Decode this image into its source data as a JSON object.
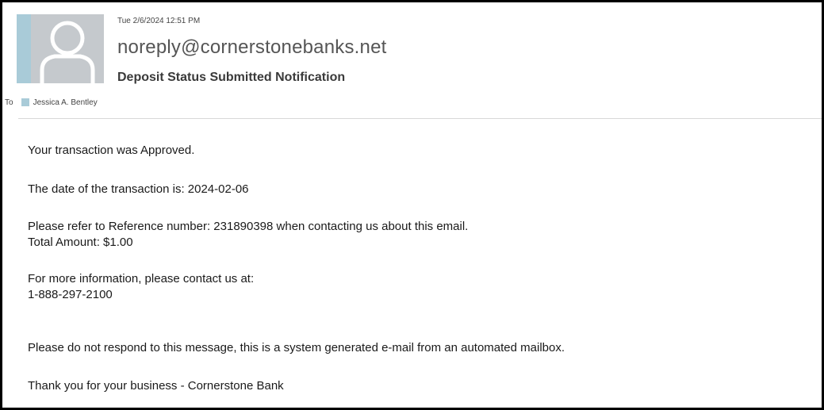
{
  "email": {
    "date": "Tue 2/6/2024 12:51 PM",
    "sender": "noreply@cornerstonebanks.net",
    "subject": "Deposit Status Submitted Notification",
    "to_label": "To",
    "recipient": "Jessica A. Bentley"
  },
  "body": {
    "line1": "Your transaction was Approved.",
    "line2": "The date of the transaction is: 2024-02-06",
    "line3": "Please refer to Reference number: 231890398 when contacting us about this email.",
    "line4": "Total Amount: $1.00",
    "line5": "For more information, please contact us at:",
    "line6": "1-888-297-2100",
    "line7": "Please do not respond to this message, this is a system generated e-mail from an automated mailbox.",
    "line8": "Thank you for your business - Cornerstone Bank"
  },
  "colors": {
    "avatar_bg": "#c5c9cd",
    "avatar_accent": "#a9cbd8",
    "frame_border": "#000000"
  }
}
